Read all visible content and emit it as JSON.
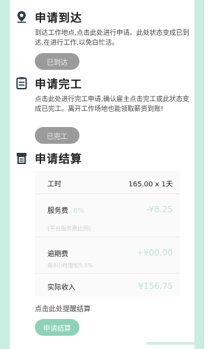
{
  "arrive": {
    "title": "申请到达",
    "desc": "到达工作地点,点击此处进行申请。此处状态变成已到达,在进行工作,以免白忙活。",
    "button": "已到达"
  },
  "complete": {
    "title": "申请完工",
    "desc": "点击此处进行完工申请,确认雇主点击完工或此状态变成已完工。离开工作场地也能领取薪资到账!",
    "button": "已完工"
  },
  "settle": {
    "title": "申请结算",
    "hours_label": "工时",
    "hours_value": "165.00 x 1天",
    "service_label": "服务费",
    "service_rate": "6%",
    "service_value": "-¥8.25",
    "service_note": "(平台服务费比例)",
    "overdue_label": "逾期费",
    "overdue_value": "+¥00.00",
    "overdue_note": "每8小时增加5.5%",
    "income_label": "实际收入",
    "income_value": "¥156.75",
    "remind_text": "点击此处提醒结算",
    "button": "申请结算"
  },
  "colors": {
    "accent": "#8fd1b9",
    "disabled": "#9b9b9b",
    "money_muted": "#bfe3d5"
  }
}
